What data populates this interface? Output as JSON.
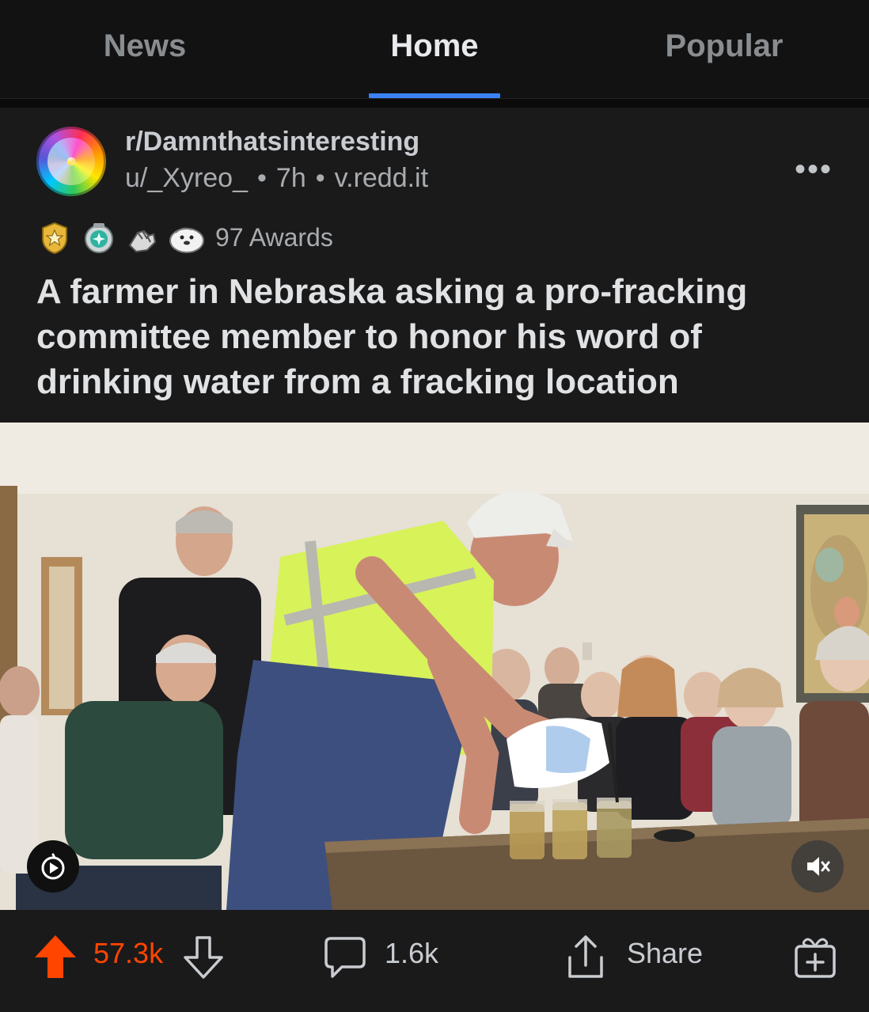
{
  "tabs": [
    {
      "label": "News"
    },
    {
      "label": "Home"
    },
    {
      "label": "Popular"
    }
  ],
  "active_tab": "Home",
  "post": {
    "subreddit": "r/Damnthatsinteresting",
    "author": "u/_Xyreo_",
    "age": "7h",
    "domain": "v.redd.it",
    "awards_label": "97 Awards",
    "title": "A farmer in Nebraska asking a pro-fracking committee member to honor his word of drinking water from a fracking location"
  },
  "actions": {
    "score": "57.3k",
    "comments": "1.6k",
    "share_label": "Share"
  },
  "colors": {
    "upvote": "#ff4500",
    "tab_indicator": "#3b82f6"
  },
  "icons": [
    "more-icon",
    "award-icons",
    "upvote-icon",
    "downvote-icon",
    "comment-icon",
    "share-icon",
    "gift-icon",
    "video-badge-icon",
    "mute-icon"
  ]
}
